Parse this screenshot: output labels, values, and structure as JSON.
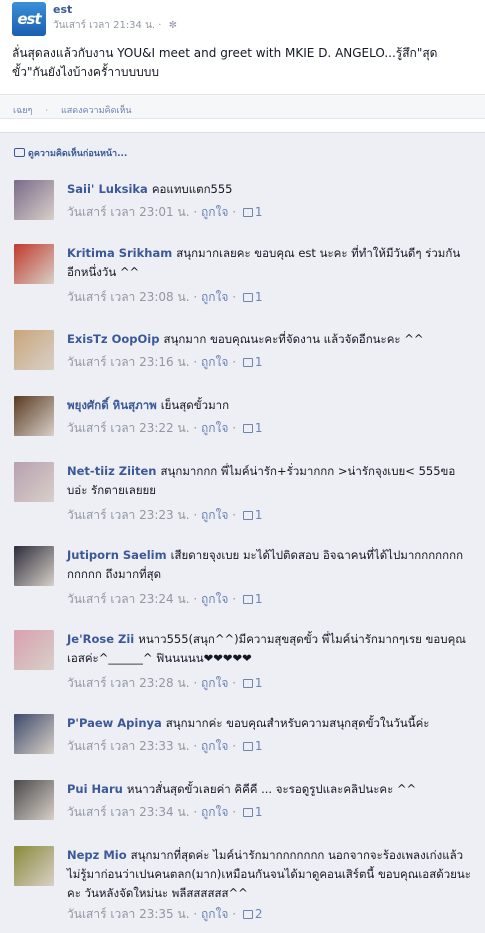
{
  "post": {
    "page_name": "est",
    "logo_text": "est",
    "time": "วันเสาร์ เวลา 21:34 น.",
    "dot": "·",
    "gear": "✼",
    "text": "ลั่นสุดลงแล้วกับงาน YOU&I meet and greet with MKIE D. ANGELO...รู้สึก\"สุดขั้ว\"กันยังไงบ้างครั้าาบบบบบ"
  },
  "actions": {
    "like_label": "เฉยๆ",
    "dot": "·",
    "comment_label": "แสดงความคิดเห็น"
  },
  "comments_box": {
    "view_previous": "ดูความคิดเห็นก่อนหน้า..."
  },
  "comments": [
    {
      "author": "Saii' Luksika",
      "text": "คอแทบแตก555",
      "time": "วันเสาร์ เวลา 23:01 น.",
      "like_label": "ถูกใจ",
      "likes": "1",
      "avatar_color": "#7a6a8a"
    },
    {
      "author": "Kritima Srikham",
      "text": "สนุกมากเลยคะ ขอบคุณ est นะคะ ที่ทำให้มีวันดีๆ ร่วมกันอีกหนึ่งวัน ^^",
      "time": "วันเสาร์ เวลา 23:08 น.",
      "like_label": "ถูกใจ",
      "likes": "1",
      "avatar_color": "#c0392b"
    },
    {
      "author": "ExisTz OopOip",
      "text": "สนุกมาก ขอบคุณนะคะที่จัดงาน แล้วจัดอีกนะคะ ^^",
      "time": "วันเสาร์ เวลา 23:16 น.",
      "like_label": "ถูกใจ",
      "likes": "1",
      "avatar_color": "#c9a57a"
    },
    {
      "author": "พยุงศักดิ์ หินสุภาพ",
      "text": "เย็นสุดขั้วมาก",
      "time": "วันเสาร์ เวลา 23:22 น.",
      "like_label": "ถูกใจ",
      "likes": "1",
      "avatar_color": "#5a3a22"
    },
    {
      "author": "Net-tiiz Ziiten",
      "text": "สนุกมากกก พี่ไมค์น่ารัก+รั่วมากกก >น่ารักจุงเบย< 555ขอบอ่ะ รักตายเลยยย",
      "time": "วันเสาร์ เวลา 23:23 น.",
      "like_label": "ถูกใจ",
      "likes": "1",
      "avatar_color": "#b8a0b0"
    },
    {
      "author": "Jutiporn Saelim",
      "text": "เสียดายจุงเบย มะได้ไปติดสอบ อิจฉาคนที่ได้ไปมากกกกกกกกกกกก ถึงมากที่สุด",
      "time": "วันเสาร์ เวลา 23:24 น.",
      "like_label": "ถูกใจ",
      "likes": "1",
      "avatar_color": "#2c2c3a"
    },
    {
      "author": "Je'Rose Zii",
      "text": "หนาว555(สนุก^^)มีความสุขสุดขั้ว พี่ไมค์น่ารักมากๆเรย ขอบคุณเอสค่ะ^______^ ฟินนนนน❤❤❤❤❤",
      "time": "วันเสาร์ เวลา 23:28 น.",
      "like_label": "ถูกใจ",
      "likes": "1",
      "avatar_color": "#d9a0b0"
    },
    {
      "author": "P'Paew Apinya",
      "text": "สนุกมากค่ะ ขอบคุณสำหรับความสนุกสุดขั้วในวันนี้ค่ะ",
      "time": "วันเสาร์ เวลา 23:33 น.",
      "like_label": "ถูกใจ",
      "likes": "1",
      "avatar_color": "#3d4a6a"
    },
    {
      "author": "Pui Haru",
      "text": "หนาวสั่นสุดขั้วเลยค่า คิคีคี ... จะรอดูรูปและคลิปนะคะ ^^",
      "time": "วันเสาร์ เวลา 23:34 น.",
      "like_label": "ถูกใจ",
      "likes": "1",
      "avatar_color": "#4a4a4a"
    },
    {
      "author": "Nepz Mio",
      "text": "สนุกมากที่สุดค่ะ ไมค์น่ารักมากกกกกกก นอกจากจะร้องเพลงเก่งแล้วไม่รู้มาก่อนว่าเปนคนตลก(มาก)เหมือนกันจนได้มาดูคอนเสิร์ตนี้ ขอบคุณเอสด้วยนะคะ วันหลังจัดใหม่นะ พลีสสสสสส^^",
      "time": "วันเสาร์ เวลา 23:35 น.",
      "like_label": "ถูกใจ",
      "likes": "2",
      "avatar_color": "#8a8a3a"
    }
  ]
}
